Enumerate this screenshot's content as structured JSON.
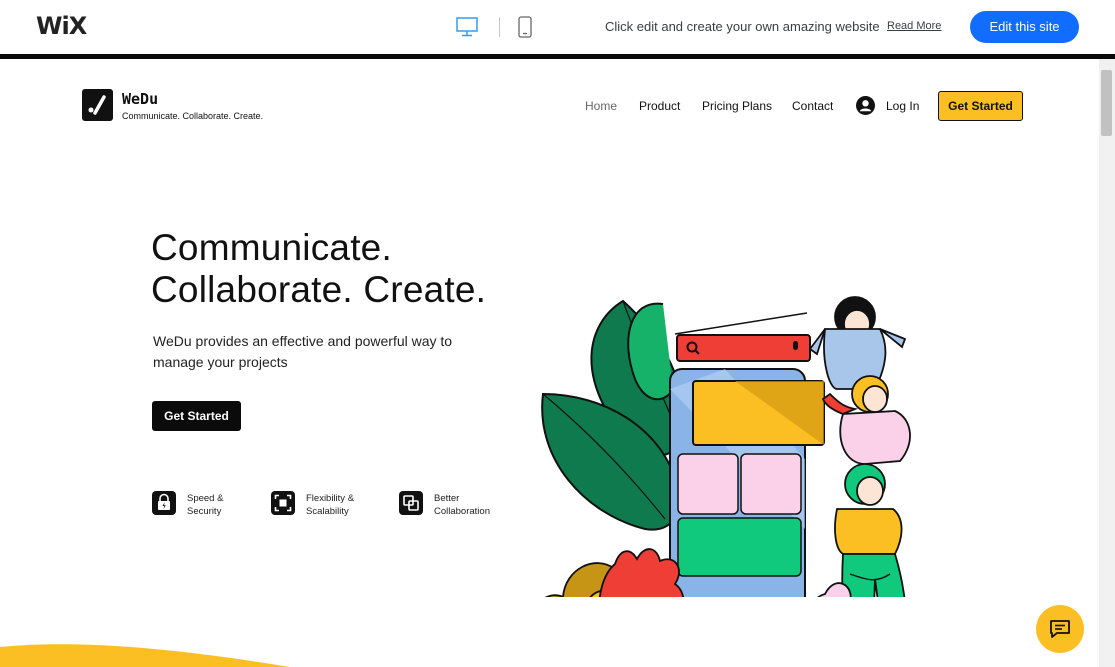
{
  "wix_bar": {
    "logo": "WiX",
    "tagline": "Click edit and create your own amazing website",
    "read_more": "Read More",
    "edit_button": "Edit this site",
    "icons": [
      "desktop-icon",
      "mobile-icon"
    ],
    "accent_color": "#116dff"
  },
  "site": {
    "brand_name": "WeDu",
    "brand_tagline": "Communicate. Collaborate. Create.",
    "nav": {
      "home": "Home",
      "product": "Product",
      "pricing": "Pricing Plans",
      "contact": "Contact",
      "login": "Log In",
      "cta": "Get Started"
    },
    "hero": {
      "title_line1": "Communicate.",
      "title_line2": "Collaborate. Create.",
      "description": "WeDu provides an effective and powerful way to manage your projects",
      "cta": "Get Started"
    },
    "features": [
      {
        "icon": "lock-icon",
        "line1": "Speed &",
        "line2": "Security"
      },
      {
        "icon": "expand-icon",
        "line1": "Flexibility &",
        "line2": "Scalability"
      },
      {
        "icon": "overlap-squares-icon",
        "line1": "Better",
        "line2": "Collaboration"
      }
    ],
    "accent_color": "#fbbf24"
  },
  "chat": {
    "icon": "chat-icon"
  }
}
